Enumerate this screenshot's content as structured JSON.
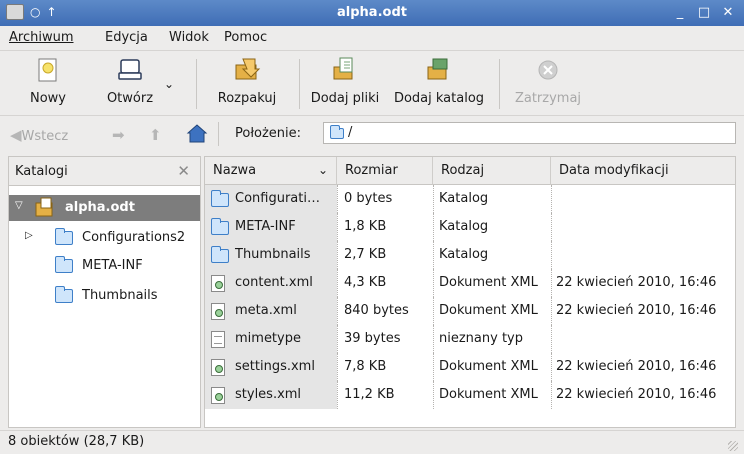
{
  "window": {
    "title": "alpha.odt",
    "controls": [
      "_",
      "□",
      "✕"
    ]
  },
  "menu": [
    "Archiwum",
    "Edycja",
    "Widok",
    "Pomoc"
  ],
  "toolbar": {
    "new": "Nowy",
    "open": "Otwórz",
    "extract": "Rozpakuj",
    "add_files": "Dodaj pliki",
    "add_folder": "Dodaj katalog",
    "stop": "Zatrzymaj"
  },
  "location": {
    "back": "Wstecz",
    "label": "Położenie:",
    "path": "/"
  },
  "sidebar": {
    "title": "Katalogi",
    "tree": [
      {
        "label": "alpha.odt",
        "selected": true
      },
      {
        "label": "Configurations2",
        "expandable": true
      },
      {
        "label": "META-INF"
      },
      {
        "label": "Thumbnails"
      }
    ]
  },
  "list": {
    "columns": [
      "Nazwa",
      "Rozmiar",
      "Rodzaj",
      "Data modyfikacji"
    ],
    "rows": [
      {
        "icon": "folder-icon",
        "name": "Configurati…",
        "size": "0 bytes",
        "type": "Katalog",
        "date": ""
      },
      {
        "icon": "folder-icon",
        "name": "META-INF",
        "size": "1,8 KB",
        "type": "Katalog",
        "date": ""
      },
      {
        "icon": "folder-icon",
        "name": "Thumbnails",
        "size": "2,7 KB",
        "type": "Katalog",
        "date": ""
      },
      {
        "icon": "xml-file-icon",
        "name": "content.xml",
        "size": "4,3 KB",
        "type": "Dokument XML",
        "date": "22 kwiecień 2010, 16:46"
      },
      {
        "icon": "xml-file-icon",
        "name": "meta.xml",
        "size": "840 bytes",
        "type": "Dokument XML",
        "date": "22 kwiecień 2010, 16:46"
      },
      {
        "icon": "text-file-icon",
        "name": "mimetype",
        "size": "39 bytes",
        "type": "nieznany typ",
        "date": ""
      },
      {
        "icon": "xml-file-icon",
        "name": "settings.xml",
        "size": "7,8 KB",
        "type": "Dokument XML",
        "date": "22 kwiecień 2010, 16:46"
      },
      {
        "icon": "xml-file-icon",
        "name": "styles.xml",
        "size": "11,2 KB",
        "type": "Dokument XML",
        "date": "22 kwiecień 2010, 16:46"
      }
    ]
  },
  "status": "8 obiektów (28,7 KB)"
}
